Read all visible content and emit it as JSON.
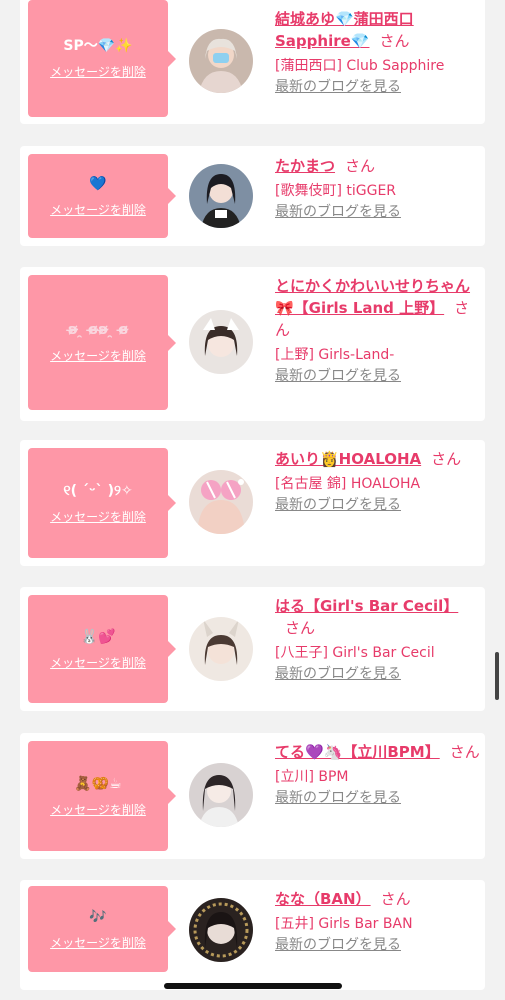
{
  "delete_label": "メッセージを削除",
  "san_label": "さん",
  "blog_label": "最新のブログを見る",
  "colors": {
    "accent": "#e73b6a",
    "bubble": "#fe97a7",
    "background": "#f2f2f2"
  },
  "entries": [
    {
      "message": "SP〜💎✨",
      "name": "結城あゆ💎蒲田西口Sapphire💎",
      "shop": "[蒲田西口] Club Sapphire"
    },
    {
      "message": "💙",
      "name": "たかまつ",
      "shop": "[歌舞伎町] tiGGER"
    },
    {
      "message": "ʚ̴̶̷̷ ̯ ɞ̴̶̷ʚ̴̶̷̷ ̯ ɞ̴̶̷",
      "name": "とにかくかわいいせりちゃん🎀【Girls Land 上野】",
      "shop": "[上野] Girls-Land-"
    },
    {
      "message": "୧( ˊᵕˋ )୨✧",
      "name": "あいり👸HOALOHA",
      "shop": "[名古屋 錦] HOALOHA"
    },
    {
      "message": "🐰💕",
      "name": "はる【Girl's Bar Cecil】",
      "shop": "[八王子] Girl's Bar Cecil"
    },
    {
      "message": "🧸🥨☕",
      "name": "てる💜🦄【立川BPM】",
      "shop": "[立川] BPM"
    },
    {
      "message": "🎶",
      "name": "なな（BAN）",
      "shop": "[五井] Girls Bar BAN"
    }
  ]
}
